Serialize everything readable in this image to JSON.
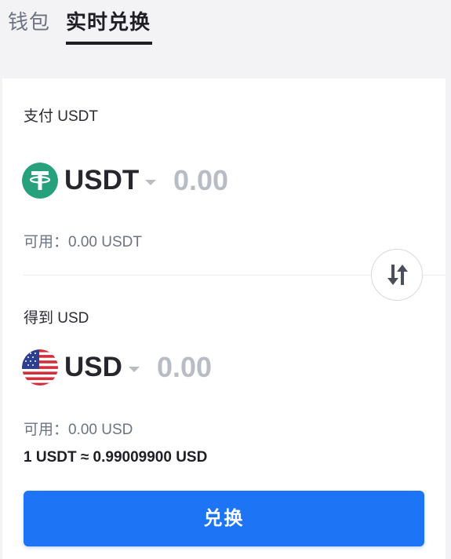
{
  "tabs": {
    "wallet_label": "钱包",
    "exchange_label": "实时兑换"
  },
  "pay": {
    "label": "支付 USDT",
    "coin_code": "USDT",
    "coin_icon": "tether-icon",
    "amount_placeholder": "0.00",
    "available": "可用：0.00 USDT"
  },
  "receive": {
    "label": "得到 USD",
    "coin_code": "USD",
    "coin_icon": "us-flag-icon",
    "amount_placeholder": "0.00",
    "available": "可用：0.00 USD"
  },
  "swap_icon": "swap-arrows-icon",
  "rate_text": "1 USDT ≈ 0.99009900 USD",
  "convert_button_label": "兑换",
  "colors": {
    "accent": "#1d74f5",
    "tether_green": "#26a17b",
    "muted_text": "#6c7383",
    "placeholder": "#b8bcc4"
  }
}
